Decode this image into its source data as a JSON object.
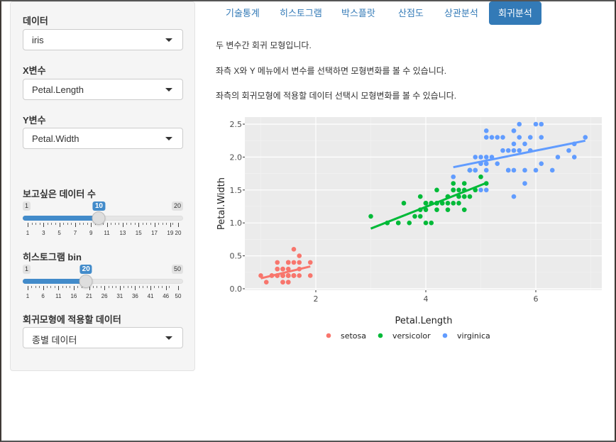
{
  "sidebar": {
    "dataset": {
      "label": "데이터",
      "value": "iris"
    },
    "x_var": {
      "label": "X변수",
      "value": "Petal.Length"
    },
    "y_var": {
      "label": "Y변수",
      "value": "Petal.Width"
    },
    "n_slider": {
      "label": "보고싶은 데이터 수",
      "min": 1,
      "max": 20,
      "value": 10,
      "min_label": "1",
      "max_label": "20",
      "value_label": "10",
      "tick_labels": [
        "1",
        "3",
        "5",
        "7",
        "9",
        "11",
        "13",
        "15",
        "17",
        "19",
        "20"
      ]
    },
    "bin_slider": {
      "label": "히스토그램 bin",
      "min": 1,
      "max": 50,
      "value": 20,
      "min_label": "1",
      "max_label": "50",
      "value_label": "20",
      "tick_labels": [
        "1",
        "6",
        "11",
        "16",
        "21",
        "26",
        "31",
        "36",
        "41",
        "46",
        "50"
      ]
    },
    "model_data": {
      "label": "회귀모형에 적용할 데이터",
      "value": "종별 데이터"
    }
  },
  "tabs": [
    {
      "label": "기술통계",
      "active": false
    },
    {
      "label": "히스토그램",
      "active": false
    },
    {
      "label": "박스플랏",
      "active": false
    },
    {
      "label": "산점도",
      "active": false
    },
    {
      "label": "상관분석",
      "active": false
    },
    {
      "label": "회귀분석",
      "active": true
    }
  ],
  "main": {
    "paragraphs": [
      "두 변수간 회귀 모형입니다.",
      "좌측 X와 Y 메뉴에서 변수를 선택하면 모형변화를 볼 수 있습니다.",
      "좌측의 회귀모형에 적용할 데이터 선택시 모형변화를 볼 수 있습니다."
    ]
  },
  "colors": {
    "setosa": "#F8766D",
    "versicolor": "#00BA38",
    "virginica": "#619CFF",
    "accent": "#337ab7",
    "panel": "#EBEBEB"
  },
  "chart_data": {
    "type": "scatter",
    "title": "",
    "xlabel": "Petal.Length",
    "ylabel": "Petal.Width",
    "xlim": [
      0.7,
      7.2
    ],
    "ylim": [
      -0.05,
      2.6
    ],
    "x_ticks": [
      2,
      4,
      6
    ],
    "x_tick_labels": [
      "2",
      "4",
      "6"
    ],
    "y_ticks": [
      0,
      0.5,
      1,
      1.5,
      2,
      2.5
    ],
    "y_tick_labels": [
      "0.0",
      "0.5",
      "1.0",
      "1.5",
      "2.0",
      "2.5"
    ],
    "grid": true,
    "legend_position": "bottom",
    "series": [
      {
        "name": "setosa",
        "x": [
          1.4,
          1.4,
          1.3,
          1.5,
          1.4,
          1.7,
          1.4,
          1.5,
          1.4,
          1.5,
          1.5,
          1.6,
          1.4,
          1.1,
          1.2,
          1.5,
          1.3,
          1.4,
          1.7,
          1.5,
          1.7,
          1.5,
          1.0,
          1.7,
          1.9,
          1.6,
          1.6,
          1.5,
          1.4,
          1.6,
          1.6,
          1.5,
          1.5,
          1.4,
          1.5,
          1.2,
          1.3,
          1.4,
          1.3,
          1.5,
          1.3,
          1.3,
          1.3,
          1.6,
          1.9,
          1.4,
          1.6,
          1.4,
          1.5,
          1.4
        ],
        "y": [
          0.2,
          0.2,
          0.2,
          0.2,
          0.2,
          0.4,
          0.3,
          0.2,
          0.2,
          0.1,
          0.2,
          0.2,
          0.1,
          0.1,
          0.2,
          0.4,
          0.4,
          0.3,
          0.3,
          0.3,
          0.2,
          0.4,
          0.2,
          0.5,
          0.2,
          0.2,
          0.4,
          0.2,
          0.2,
          0.2,
          0.2,
          0.4,
          0.1,
          0.2,
          0.2,
          0.2,
          0.2,
          0.1,
          0.2,
          0.2,
          0.3,
          0.3,
          0.2,
          0.6,
          0.4,
          0.3,
          0.2,
          0.2,
          0.2,
          0.2
        ],
        "fit": {
          "x": [
            1.0,
            1.9
          ],
          "y": [
            0.158,
            0.339
          ]
        }
      },
      {
        "name": "versicolor",
        "x": [
          4.7,
          4.5,
          4.9,
          4.0,
          4.6,
          4.5,
          4.7,
          3.3,
          4.6,
          3.9,
          3.5,
          4.2,
          4.0,
          4.7,
          3.6,
          4.4,
          4.5,
          4.1,
          4.5,
          3.9,
          4.8,
          4.0,
          4.9,
          4.7,
          4.3,
          4.4,
          4.8,
          5.0,
          4.5,
          3.5,
          3.8,
          3.7,
          3.9,
          5.1,
          4.5,
          4.5,
          4.7,
          4.4,
          4.1,
          4.0,
          4.4,
          4.6,
          4.0,
          3.3,
          4.2,
          4.2,
          4.2,
          4.3,
          3.0,
          4.1
        ],
        "y": [
          1.4,
          1.5,
          1.5,
          1.3,
          1.5,
          1.3,
          1.6,
          1.0,
          1.3,
          1.4,
          1.0,
          1.5,
          1.0,
          1.4,
          1.3,
          1.4,
          1.5,
          1.0,
          1.5,
          1.1,
          1.8,
          1.3,
          1.5,
          1.2,
          1.3,
          1.4,
          1.4,
          1.7,
          1.5,
          1.0,
          1.1,
          1.0,
          1.2,
          1.6,
          1.5,
          1.6,
          1.5,
          1.3,
          1.3,
          1.3,
          1.2,
          1.4,
          1.2,
          1.0,
          1.3,
          1.2,
          1.3,
          1.3,
          1.1,
          1.3
        ],
        "fit": {
          "x": [
            3.0,
            5.1
          ],
          "y": [
            0.914,
            1.607
          ]
        }
      },
      {
        "name": "virginica",
        "x": [
          6.0,
          5.1,
          5.9,
          5.6,
          5.8,
          6.6,
          4.5,
          6.3,
          5.8,
          6.1,
          5.1,
          5.3,
          5.5,
          5.0,
          5.1,
          5.3,
          5.5,
          6.7,
          6.9,
          5.0,
          5.7,
          4.9,
          6.7,
          4.9,
          5.7,
          6.0,
          4.8,
          4.9,
          5.6,
          5.8,
          6.1,
          6.4,
          5.6,
          5.1,
          5.6,
          6.1,
          5.6,
          5.5,
          4.8,
          5.4,
          5.6,
          5.1,
          5.1,
          5.9,
          5.7,
          5.2,
          5.0,
          5.2,
          5.4,
          5.1
        ],
        "y": [
          2.5,
          1.9,
          2.1,
          1.8,
          2.2,
          2.1,
          1.7,
          1.8,
          1.8,
          2.5,
          2.0,
          1.9,
          2.1,
          2.0,
          2.4,
          2.3,
          1.8,
          2.2,
          2.3,
          1.5,
          2.3,
          2.0,
          2.0,
          1.8,
          2.1,
          1.8,
          1.8,
          1.8,
          2.1,
          1.6,
          1.9,
          2.0,
          2.2,
          1.5,
          1.4,
          2.3,
          2.4,
          1.8,
          1.8,
          2.1,
          2.4,
          2.3,
          1.9,
          2.3,
          2.5,
          2.3,
          1.9,
          2.0,
          2.3,
          1.8
        ],
        "fit": {
          "x": [
            4.5,
            6.9
          ],
          "y": [
            1.846,
            2.249
          ]
        }
      }
    ]
  }
}
